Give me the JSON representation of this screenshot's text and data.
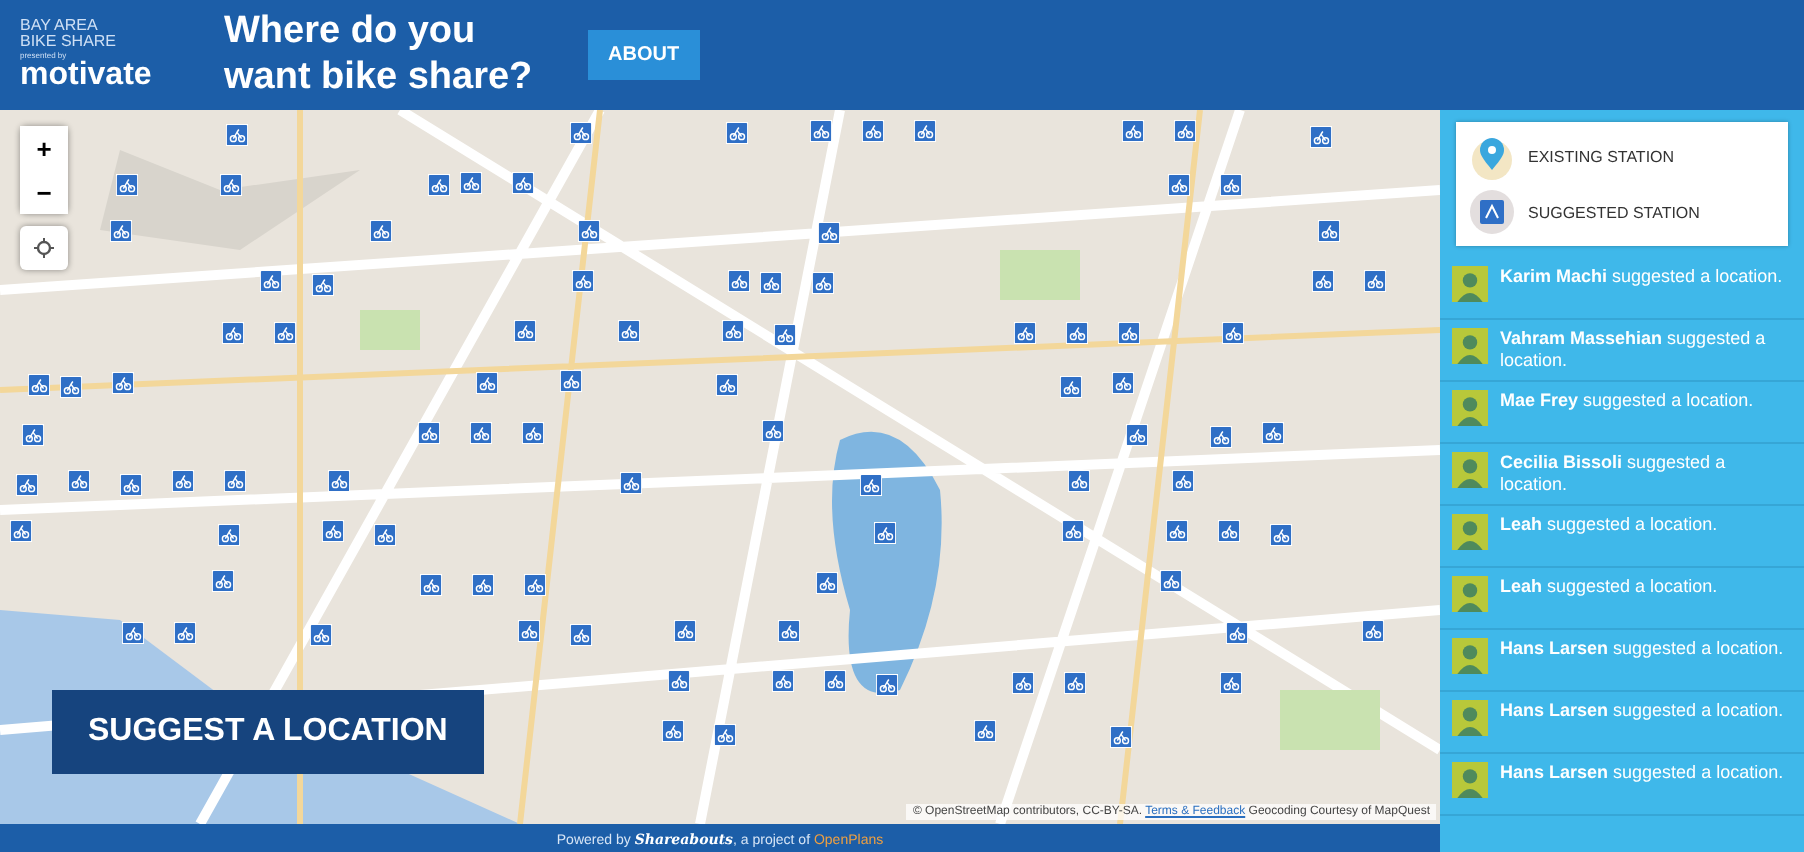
{
  "header": {
    "logo_top": "BAY AREA",
    "logo_middle": "BIKE SHARE",
    "logo_small": "presented by",
    "logo_brand": "motivate",
    "headline": "Where do you want bike share?",
    "about_button": "ABOUT"
  },
  "map": {
    "zoom_in": "+",
    "zoom_out": "−",
    "suggest_button": "SUGGEST A LOCATION",
    "attribution": {
      "prefix": "© OpenStreetMap contributors, CC-BY-SA.",
      "terms": "Terms & Feedback",
      "geocoding": "Geocoding Courtesy of MapQuest"
    }
  },
  "legend": [
    {
      "kind": "existing",
      "label": "EXISTING STATION"
    },
    {
      "kind": "suggested",
      "label": "SUGGESTED STATION"
    }
  ],
  "activity": [
    {
      "name": "Karim Machi",
      "action": "suggested a location."
    },
    {
      "name": "Vahram Massehian",
      "action": "suggested a location."
    },
    {
      "name": "Mae Frey",
      "action": "suggested a location."
    },
    {
      "name": "Cecilia Bissoli",
      "action": "suggested a location."
    },
    {
      "name": "Leah",
      "action": "suggested a location."
    },
    {
      "name": "Leah",
      "action": "suggested a location."
    },
    {
      "name": "Hans Larsen",
      "action": "suggested a location."
    },
    {
      "name": "Hans Larsen",
      "action": "suggested a location."
    },
    {
      "name": "Hans Larsen",
      "action": "suggested a location."
    }
  ],
  "footer": {
    "prefix": "Powered by",
    "brand_link": "Shareabouts",
    "middle": ", a project of",
    "org_link": "OpenPlans"
  }
}
